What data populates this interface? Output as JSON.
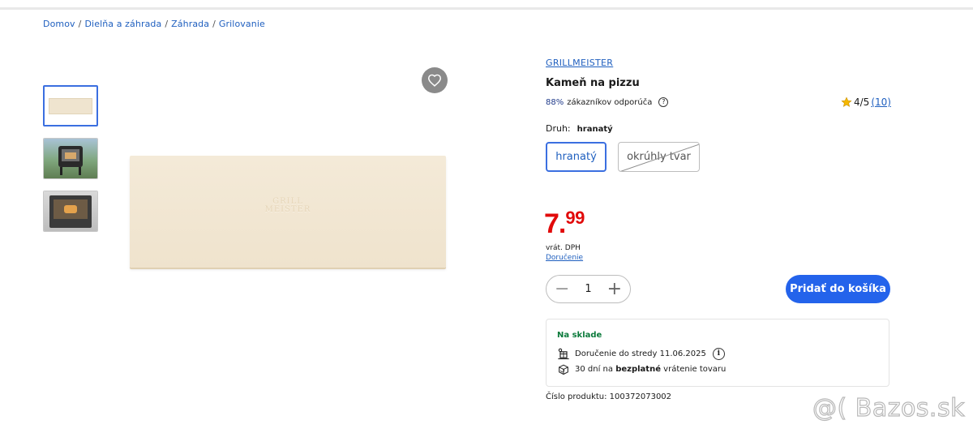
{
  "breadcrumb": [
    {
      "label": "Domov"
    },
    {
      "label": "Dielňa a záhrada"
    },
    {
      "label": "Záhrada"
    },
    {
      "label": "Grilovanie"
    }
  ],
  "product": {
    "brand": "GRILLMEISTER",
    "title": "Kameň na pizzu",
    "image_emboss_line1": "GRILL",
    "image_emboss_line2": "MEISTER",
    "recommend_pct": "88%",
    "recommend_text": "zákazníkov odporúča",
    "rating_text": "4/5",
    "rating_count": "(10)",
    "variant_label": "Druh:",
    "variant_value": "hranatý",
    "options": [
      {
        "label": "hranatý",
        "state": "selected"
      },
      {
        "label": "okrúhly tvar",
        "state": "unavailable"
      }
    ],
    "price_int": "7.",
    "price_dec": "99",
    "vat_text": "vrát. DPH",
    "delivery_link": "Doručenie",
    "quantity": "1",
    "add_to_cart": "Pridať do košíka",
    "stock_title": "Na sklade",
    "delivery_text": "Doručenie do stredy 11.06.2025",
    "return_prefix": "30 dní na",
    "return_bold": "bezplatné",
    "return_suffix": "vrátenie tovaru",
    "product_number": "Číslo produktu: 100372073002"
  },
  "watermark": "@( Bazos.sk",
  "colors": {
    "link": "#1f5fbf",
    "accent": "#2463eb",
    "price": "#e10a0a",
    "in_stock": "#0b7a3b"
  }
}
